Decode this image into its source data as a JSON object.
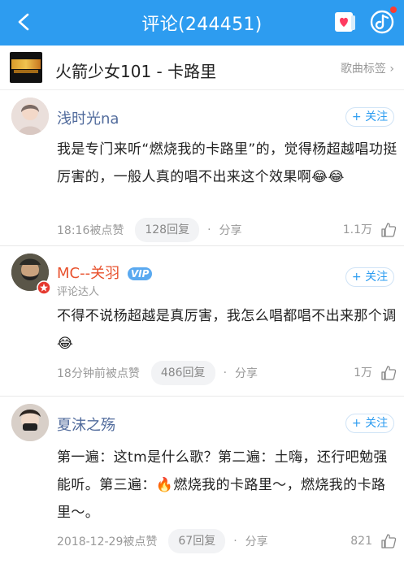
{
  "topbar": {
    "title": "评论(244451)"
  },
  "song": {
    "title": "火箭少女101 - 卡路里",
    "tag_label": "歌曲标签 ›"
  },
  "comments": [
    {
      "username": "浅时光na",
      "follow_label": "+ 关注",
      "text": "我是专门来听“燃烧我的卡路里”的，觉得杨超越唱功挺厉害的，一般人真的唱不出来这个效果啊😂😂",
      "time": "18:16被点赞",
      "reply_label": "128回复",
      "share_label": "分享",
      "likes": "1.1万"
    },
    {
      "username": "MC--关羽",
      "badge": "VIP",
      "subtitle": "评论达人",
      "follow_label": "+ 关注",
      "text": "不得不说杨超越是真厉害，我怎么唱都唱不出来那个调😂",
      "time": "18分钟前被点赞",
      "reply_label": "486回复",
      "share_label": "分享",
      "likes": "1万"
    },
    {
      "username": "夏沫之殇",
      "follow_label": "+ 关注",
      "text": "第一遍：这tm是什么歌？第二遍：土嗨，还行吧勉强能听。第三遍：🔥燃烧我的卡路里～，燃烧我的卡路里～。",
      "time": "2018-12-29被点赞",
      "reply_label": "67回复",
      "share_label": "分享",
      "likes": "821"
    }
  ]
}
